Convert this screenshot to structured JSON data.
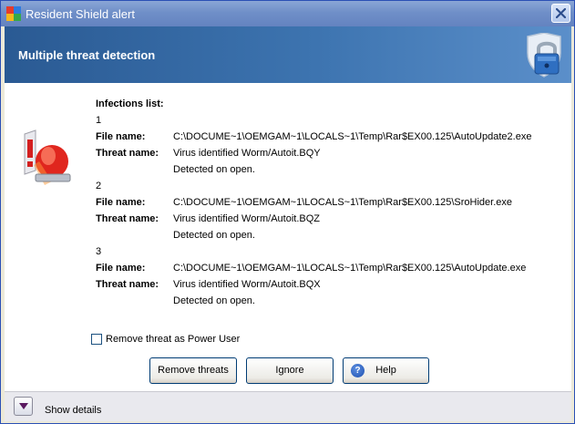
{
  "window": {
    "title": "Resident Shield alert"
  },
  "header": {
    "title": "Multiple threat detection"
  },
  "infections": {
    "heading": "Infections list:",
    "file_label": "File name:",
    "threat_label": "Threat name:",
    "items": [
      {
        "index": "1",
        "file": "C:\\DOCUME~1\\OEMGAM~1\\LOCALS~1\\Temp\\Rar$EX00.125\\AutoUpdate2.exe",
        "threat": "Virus identified Worm/Autoit.BQY",
        "detected": "Detected on open."
      },
      {
        "index": "2",
        "file": "C:\\DOCUME~1\\OEMGAM~1\\LOCALS~1\\Temp\\Rar$EX00.125\\SroHider.exe",
        "threat": "Virus identified Worm/Autoit.BQZ",
        "detected": "Detected on open."
      },
      {
        "index": "3",
        "file": "C:\\DOCUME~1\\OEMGAM~1\\LOCALS~1\\Temp\\Rar$EX00.125\\AutoUpdate.exe",
        "threat": "Virus identified Worm/Autoit.BQX",
        "detected": "Detected on open."
      }
    ]
  },
  "options": {
    "power_user_label": "Remove threat as Power User",
    "power_user_checked": false
  },
  "buttons": {
    "remove_label": "Remove threats",
    "ignore_label": "Ignore",
    "help_label": "Help",
    "help_glyph": "?"
  },
  "footer": {
    "show_details_label": "Show details"
  },
  "icons": {
    "app": "avg-app-icon",
    "close": "close-icon",
    "shield_lock": "shield-lock-icon",
    "alarm": "alarm-siren-icon",
    "help": "help-icon",
    "expand": "chevron-down-icon"
  },
  "colors": {
    "header_dark": "#2a5a93",
    "header_light": "#5b8fca",
    "titlebar": "#6f8fc8"
  }
}
